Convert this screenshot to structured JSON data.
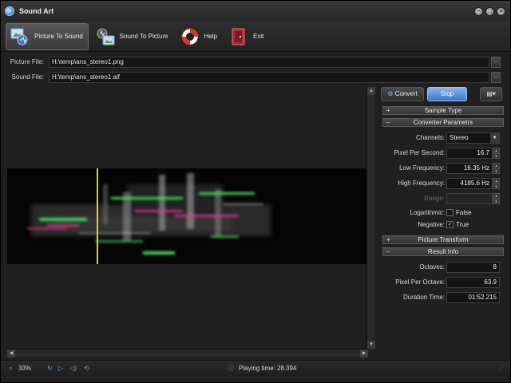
{
  "window": {
    "title": "Sound Art"
  },
  "toolbar": {
    "items": [
      {
        "label": "Picture To Sound",
        "active": true
      },
      {
        "label": "Sound To Picture",
        "active": false
      },
      {
        "label": "Help",
        "active": false
      },
      {
        "label": "Exit",
        "active": false
      }
    ]
  },
  "files": {
    "picture_label": "Picture File:",
    "picture_value": "H:\\temp\\ans_stereo1.png",
    "sound_label": "Sound File:",
    "sound_value": "H:\\temp\\ans_stereo1.aif",
    "browse_label": "..."
  },
  "panel": {
    "convert_label": "Convert",
    "stop_label": "Stop",
    "sections": {
      "sample_type": "Sample Type",
      "converter": "Converter Parametrs",
      "picture_transform": "Picture Transform",
      "result_info": "Result Info"
    },
    "params": {
      "channels_label": "Channels:",
      "channels_value": "Stereo",
      "pps_label": "Pixel Per Second:",
      "pps_value": "16.7",
      "lowf_label": "Low Frequency:",
      "lowf_value": "16.35 Hz",
      "highf_label": "High Frequency:",
      "highf_value": "4185.6 Hz",
      "range_label": "Range:",
      "range_value": "",
      "log_label": "Logarithmic:",
      "log_value": "False",
      "neg_label": "Negative:",
      "neg_value": "True"
    },
    "result": {
      "octaves_label": "Octaves:",
      "octaves_value": "8",
      "ppo_label": "Pixel Per Octave:",
      "ppo_value": "63.9",
      "duration_label": "Duration Time:",
      "duration_value": "01:52.215"
    }
  },
  "status": {
    "zoom": "33%",
    "playing_time": "Playing time: 28.394"
  },
  "colors": {
    "accent": "#4a8ad8",
    "playhead": "#d9d619",
    "spectro_green": "#3ed65a",
    "spectro_magenta": "#c0307a"
  }
}
